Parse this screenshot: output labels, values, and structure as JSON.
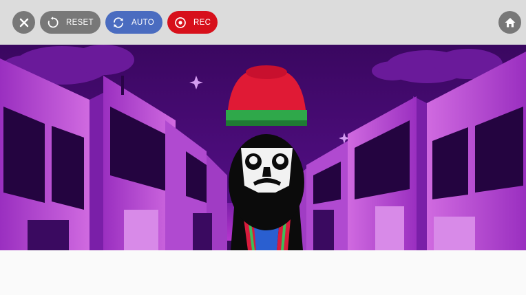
{
  "toolbar": {
    "close_icon": "close-icon",
    "reset_label": "RESET",
    "reset_icon": "reset-icon",
    "auto_label": "AUTO",
    "auto_icon": "auto-refresh-icon",
    "rec_label": "REC",
    "rec_icon": "record-icon",
    "home_icon": "home-icon"
  },
  "colors": {
    "toolbar_bg": "#dcdcdc",
    "button_gray": "#787878",
    "auto_blue": "#4a6cc0",
    "rec_red": "#d7101b",
    "scene_purple": "#4a0a78",
    "building_pink": "#c060d8"
  },
  "scene": {
    "character": "hat-character"
  }
}
